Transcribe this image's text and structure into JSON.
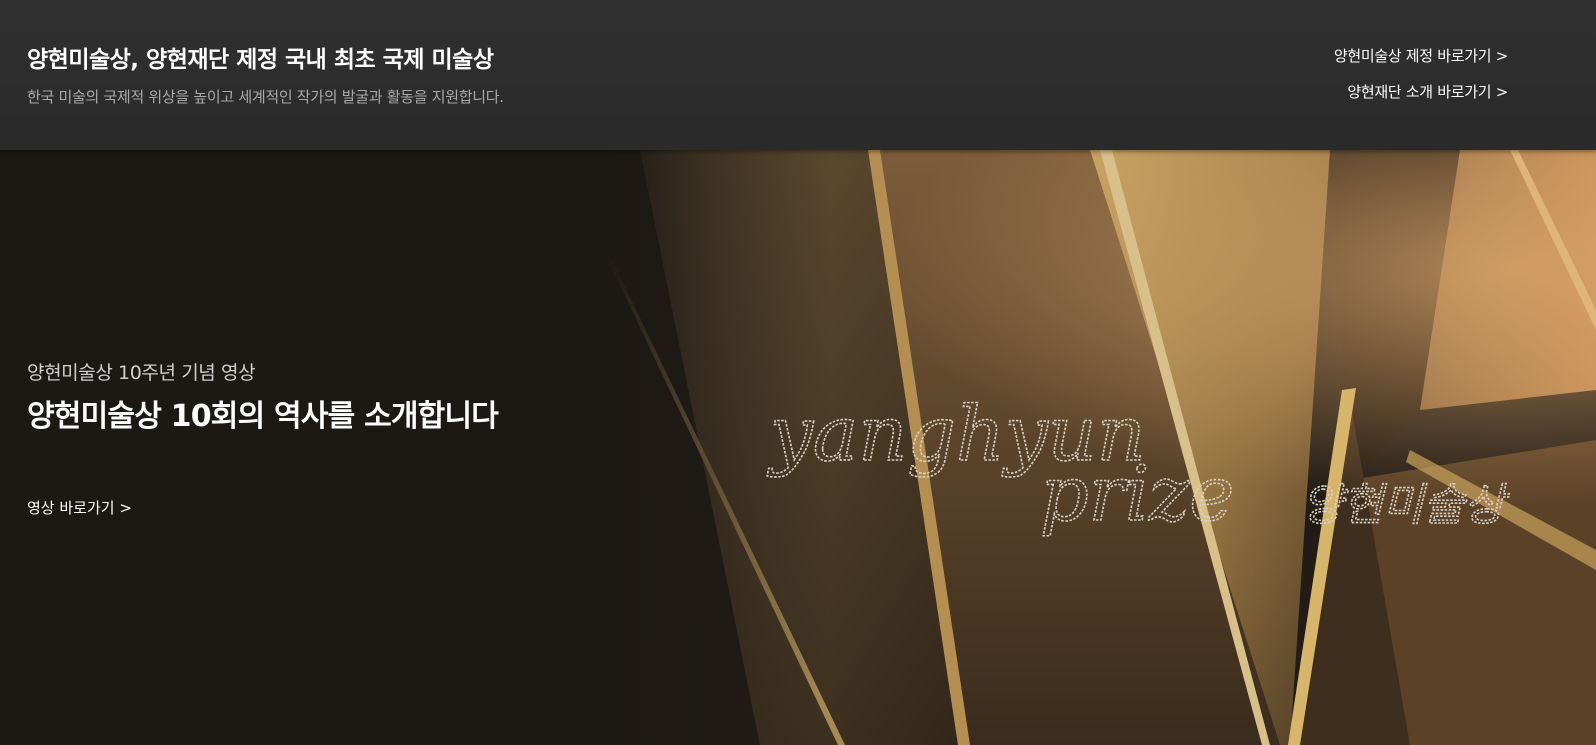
{
  "header": {
    "title": "양현미술상, 양현재단 제정 국내 최초 국제 미술상",
    "subtitle": "한국 미술의 국제적 위상을 높이고 세계적인 작가의 발굴과 활동을 지원합니다.",
    "links": [
      "양현미술상 제정 바로가기 >",
      "양현재단 소개 바로가기 >"
    ]
  },
  "hero": {
    "kicker": "양현미술상 10주년 기념 영상",
    "title": "양현미술상 10회의 역사를 소개합니다",
    "link": "영상 바로가기 >",
    "logo_line1": "yanghyun",
    "logo_line2": "prize",
    "logo_korean": "양현미술상"
  },
  "colors": {
    "topbar_bg": "#2c2c2c",
    "hero_bg": "#1c1814",
    "gold": "#c9a25a"
  }
}
